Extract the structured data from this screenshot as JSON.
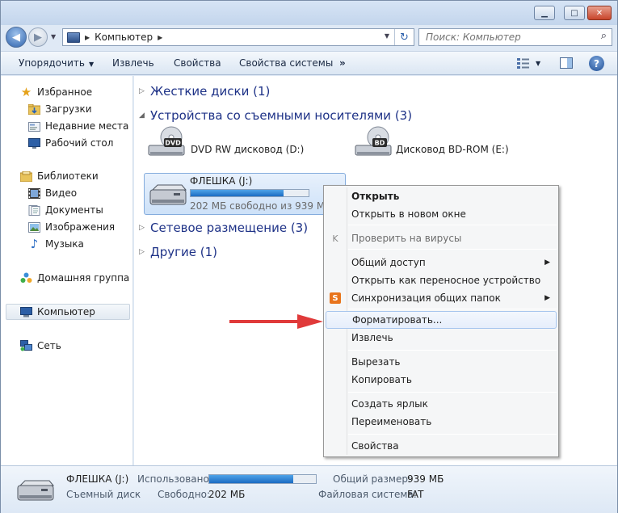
{
  "window": {
    "minimize_icon": "minimize-icon",
    "maximize_icon": "maximize-icon",
    "close_icon": "close-icon"
  },
  "navigation": {
    "back_icon": "back-arrow-icon",
    "forward_icon": "forward-arrow-icon",
    "address_path": "Компьютер",
    "search_placeholder": "Поиск: Компьютер"
  },
  "toolbar": {
    "organize": "Упорядочить",
    "eject": "Извлечь",
    "properties": "Свойства",
    "system_properties": "Свойства системы",
    "more": "»"
  },
  "sidebar": {
    "items": [
      {
        "label": "Избранное",
        "icon": "star-icon"
      },
      {
        "label": "Загрузки",
        "icon": "downloads-folder-icon"
      },
      {
        "label": "Недавние места",
        "icon": "recent-places-icon"
      },
      {
        "label": "Рабочий стол",
        "icon": "desktop-icon"
      },
      {
        "label": "Библиотеки",
        "icon": "libraries-icon"
      },
      {
        "label": "Видео",
        "icon": "video-icon"
      },
      {
        "label": "Документы",
        "icon": "documents-icon"
      },
      {
        "label": "Изображения",
        "icon": "pictures-icon"
      },
      {
        "label": "Музыка",
        "icon": "music-icon"
      },
      {
        "label": "Домашняя группа",
        "icon": "homegroup-icon"
      },
      {
        "label": "Компьютер",
        "icon": "computer-icon"
      },
      {
        "label": "Сеть",
        "icon": "network-icon"
      }
    ]
  },
  "content": {
    "groups": {
      "hard_disks": "Жесткие диски (1)",
      "removable": "Устройства со съемными носителями (3)",
      "network": "Сетевое размещение (3)",
      "other": "Другие (1)"
    },
    "drives": {
      "dvd": {
        "name": "DVD RW дисковод (D:)",
        "badge": "DVD"
      },
      "bd": {
        "name": "Дисковод BD-ROM (E:)",
        "badge": "BD"
      },
      "usb": {
        "name": "ФЛЕШКА (J:)",
        "free": "202 МБ свободно из 939 МБ",
        "used_fraction": 0.785
      }
    }
  },
  "context_menu": {
    "items": [
      {
        "label": "Открыть",
        "bold": true
      },
      {
        "label": "Открыть в новом окне"
      },
      {
        "label": "Проверить на вирусы",
        "disabled": true
      },
      {
        "label": "Общий доступ",
        "submenu": true
      },
      {
        "label": "Открыть как переносное устройство"
      },
      {
        "label": "Синхронизация общих папок",
        "submenu": true
      },
      {
        "label": "Форматировать..."
      },
      {
        "label": "Извлечь"
      },
      {
        "label": "Вырезать"
      },
      {
        "label": "Копировать"
      },
      {
        "label": "Создать ярлык"
      },
      {
        "label": "Переименовать"
      },
      {
        "label": "Свойства"
      }
    ],
    "submenu_arrow": "▶",
    "sync_badge": "S"
  },
  "details": {
    "name": "ФЛЕШКА (J:)",
    "type": "Съемный диск",
    "used_label": "Использовано:",
    "free_label": "Свободно:",
    "free_value": "202 МБ",
    "total_label": "Общий размер:",
    "total_value": "939 МБ",
    "fs_label": "Файловая система:",
    "fs_value": "FAT",
    "used_fraction": 0.785
  },
  "colors": {
    "accent_arrow": "#e03a3a",
    "group_heading": "#1e3287"
  }
}
